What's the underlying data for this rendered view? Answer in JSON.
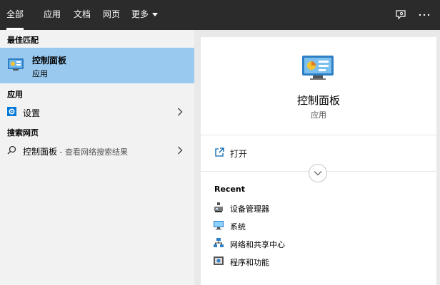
{
  "tabs": [
    {
      "label": "全部",
      "active": true
    },
    {
      "label": "应用"
    },
    {
      "label": "文档"
    },
    {
      "label": "网页"
    },
    {
      "label": "更多"
    }
  ],
  "top_icons": [
    "feedback-icon",
    "more-options-icon"
  ],
  "left": {
    "best_match_header": "最佳匹配",
    "best_match": {
      "title": "控制面板",
      "subtitle": "应用",
      "icon": "control-panel-icon"
    },
    "apps_header": "应用",
    "apps": [
      {
        "label": "设置",
        "icon": "settings-icon"
      }
    ],
    "web_header": "搜索网页",
    "web": [
      {
        "label": "控制面板",
        "suffix": " - 查看网络搜索结果",
        "icon": "search-icon"
      }
    ]
  },
  "right": {
    "title": "控制面板",
    "subtitle": "应用",
    "open_label": "打开",
    "recent_header": "Recent",
    "recent": [
      {
        "label": "设备管理器",
        "icon": "device-manager-icon"
      },
      {
        "label": "系统",
        "icon": "system-icon"
      },
      {
        "label": "网络和共享中心",
        "icon": "network-icon"
      },
      {
        "label": "程序和功能",
        "icon": "programs-icon"
      }
    ]
  },
  "colors": {
    "topbar": "#2b2b2b",
    "selection": "#99c9ef",
    "left_bg": "#f2f2f2",
    "right_bg": "#ffffff"
  }
}
